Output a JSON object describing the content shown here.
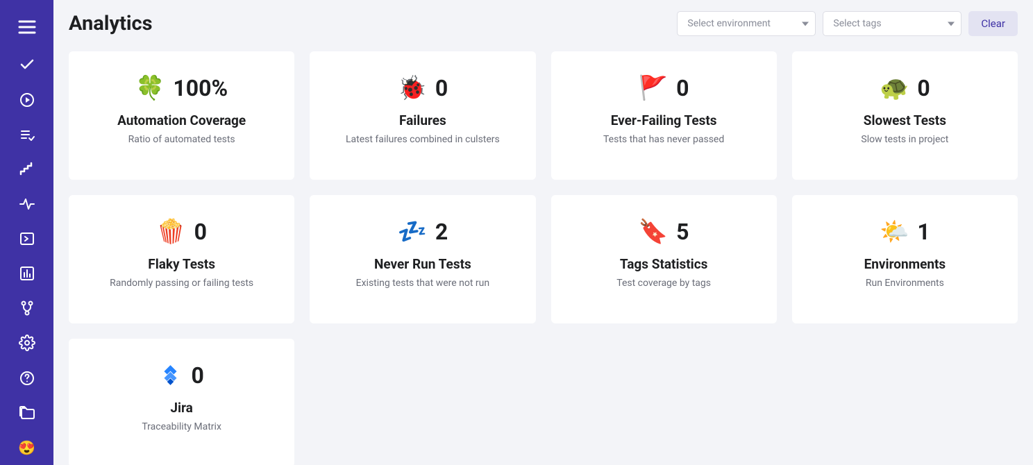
{
  "header": {
    "title": "Analytics",
    "env_placeholder": "Select environment",
    "tags_placeholder": "Select tags",
    "clear_label": "Clear"
  },
  "cards": [
    {
      "icon": "🍀",
      "value": "100%",
      "title": "Automation Coverage",
      "subtitle": "Ratio of automated tests"
    },
    {
      "icon": "🐞",
      "value": "0",
      "title": "Failures",
      "subtitle": "Latest failures combined in culsters"
    },
    {
      "icon": "🚩",
      "value": "0",
      "title": "Ever-Failing Tests",
      "subtitle": "Tests that has never passed"
    },
    {
      "icon": "🐢",
      "value": "0",
      "title": "Slowest Tests",
      "subtitle": "Slow tests in project"
    },
    {
      "icon": "🍿",
      "value": "0",
      "title": "Flaky Tests",
      "subtitle": "Randomly passing or failing tests"
    },
    {
      "icon": "💤",
      "value": "2",
      "title": "Never Run Tests",
      "subtitle": "Existing tests that were not run"
    },
    {
      "icon": "🔖",
      "value": "5",
      "title": "Tags Statistics",
      "subtitle": "Test coverage by tags"
    },
    {
      "icon": "🌤️",
      "value": "1",
      "title": "Environments",
      "subtitle": "Run Environments"
    },
    {
      "icon": "jira",
      "value": "0",
      "title": "Jira",
      "subtitle": "Traceability Matrix"
    }
  ]
}
